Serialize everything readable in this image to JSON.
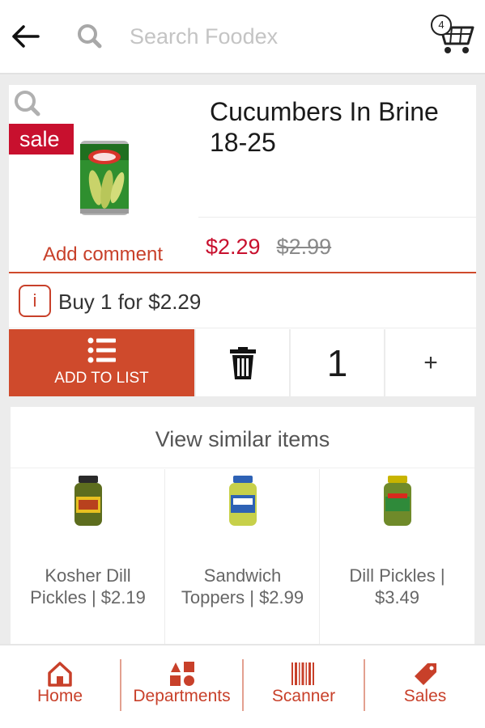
{
  "header": {
    "search_placeholder": "Search Foodex",
    "cart_count": "4"
  },
  "product": {
    "sale_badge": "sale",
    "title": "Cucumbers In Brine 18-25",
    "add_comment": "Add comment",
    "price_now": "$2.29",
    "price_old": "$2.99",
    "promo": "Buy 1 for $2.29",
    "promo_icon": "i",
    "add_to_list_label": "ADD TO LIST",
    "quantity": "1",
    "plus_label": "+"
  },
  "similar": {
    "heading": "View similar items",
    "items": [
      {
        "label": "Kosher Dill Pickles | $2.19",
        "icon": "pickle-jar-icon"
      },
      {
        "label": "Sandwich Toppers | $2.99",
        "icon": "pickle-jar-icon"
      },
      {
        "label": "Dill Pickles | $3.49",
        "icon": "pickle-jar-icon"
      }
    ]
  },
  "nav": {
    "items": [
      {
        "label": "Home",
        "icon": "home-icon"
      },
      {
        "label": "Departments",
        "icon": "departments-icon"
      },
      {
        "label": "Scanner",
        "icon": "barcode-icon"
      },
      {
        "label": "Sales",
        "icon": "sale-tag-icon"
      }
    ]
  },
  "colors": {
    "accent": "#cf4a2c",
    "sale_red": "#c8102e",
    "background": "#ececec"
  }
}
